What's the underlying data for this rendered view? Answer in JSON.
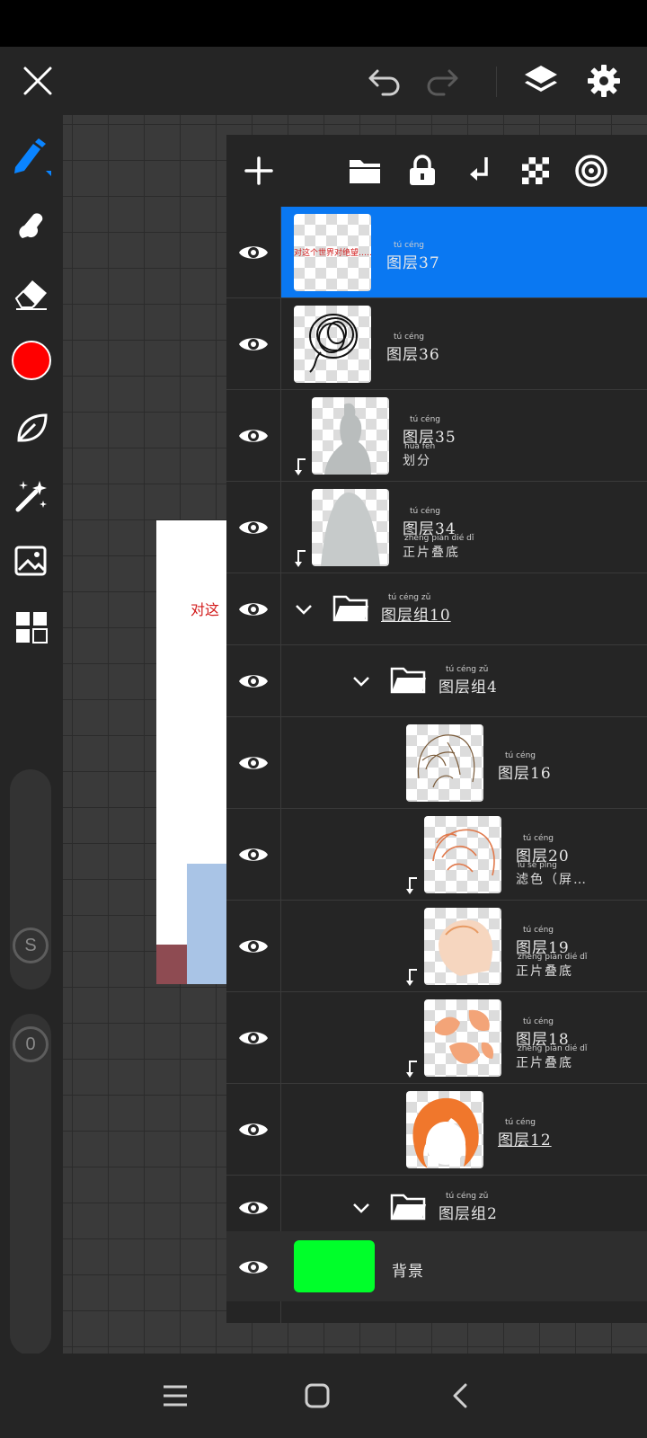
{
  "top_bar": {
    "icons": [
      "close-icon",
      "undo-icon",
      "redo-icon",
      "layers-icon",
      "settings-icon"
    ],
    "redo_enabled": false
  },
  "tools": {
    "items": [
      "brush-tool",
      "smudge-tool",
      "eraser-tool",
      "color-swatch",
      "lasso-tool",
      "magic-wand-tool",
      "image-import-tool",
      "grid-menu-tool"
    ],
    "active": "brush-tool",
    "current_color": "#ff0000"
  },
  "sliders": {
    "size_label": "S",
    "opacity_label": "0"
  },
  "canvas": {
    "visible_text": "对这"
  },
  "layers_panel": {
    "toolbar_icons": [
      "add-layer-icon",
      "folder-icon",
      "lock-icon",
      "clip-icon",
      "alpha-lock-icon",
      "reference-icon"
    ],
    "layers": [
      {
        "name": "图层37",
        "ruby": "tú céng",
        "selected": true,
        "thumb_text": "对这个世界对绝望……"
      },
      {
        "name": "图层36",
        "ruby": "tú céng"
      },
      {
        "name": "图层35",
        "ruby": "tú céng",
        "blend": "划分",
        "blend_ruby": "huà fēn",
        "clipped": true
      },
      {
        "name": "图层34",
        "ruby": "tú céng",
        "blend": "正片叠底",
        "blend_ruby": "zhèng piàn dié dǐ",
        "clipped": true
      },
      {
        "name": "图层组10",
        "ruby": "tú céng zǔ",
        "type": "group"
      },
      {
        "name": "图层组4",
        "ruby": "tú céng zǔ",
        "type": "group"
      },
      {
        "name": "图层16",
        "ruby": "tú céng"
      },
      {
        "name": "图层20",
        "ruby": "tú céng",
        "blend": "滤色（屏…",
        "blend_ruby": "lǜ sè píng",
        "clipped": true
      },
      {
        "name": "图层19",
        "ruby": "tú céng",
        "blend": "正片叠底",
        "blend_ruby": "zhèng piàn dié dǐ",
        "clipped": true
      },
      {
        "name": "图层18",
        "ruby": "tú céng",
        "blend": "正片叠底",
        "blend_ruby": "zhèng piàn dié dǐ",
        "clipped": true
      },
      {
        "name": "图层12",
        "ruby": "tú céng"
      },
      {
        "name": "图层组2",
        "ruby": "tú céng zǔ",
        "type": "group"
      },
      {
        "name": "背景",
        "type": "background",
        "color": "#00ff2a"
      }
    ]
  },
  "nav_bar": {
    "icons": [
      "recent-apps-icon",
      "home-icon",
      "back-icon"
    ]
  }
}
